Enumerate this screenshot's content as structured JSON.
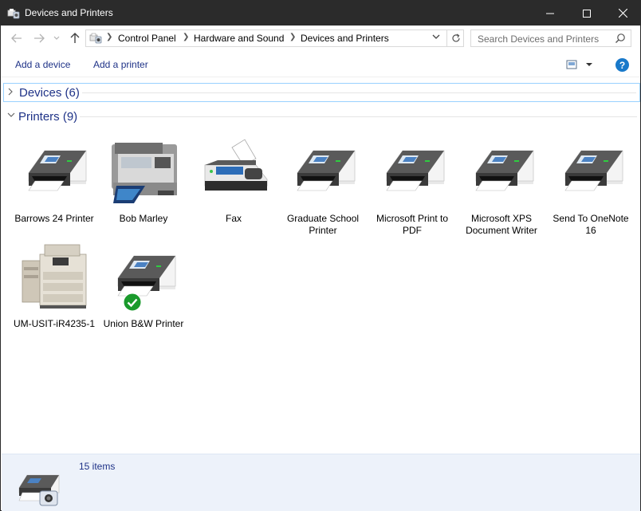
{
  "window": {
    "title": "Devices and Printers"
  },
  "address": {
    "breadcrumbs": [
      "Control Panel",
      "Hardware and Sound",
      "Devices and Printers"
    ]
  },
  "search": {
    "placeholder": "Search Devices and Printers"
  },
  "commands": {
    "add_device": "Add a device",
    "add_printer": "Add a printer",
    "help": "?"
  },
  "groups": {
    "devices": {
      "title": "Devices (6)",
      "expanded": false
    },
    "printers": {
      "title": "Printers (9)",
      "expanded": true
    }
  },
  "printers": [
    {
      "label": "Barrows 24 Printer",
      "icon": "printer-icon"
    },
    {
      "label": "Bob Marley",
      "icon": "mfp-printer-icon"
    },
    {
      "label": "Fax",
      "icon": "fax-icon"
    },
    {
      "label": "Graduate School Printer",
      "icon": "printer-icon"
    },
    {
      "label": "Microsoft Print to PDF",
      "icon": "printer-icon"
    },
    {
      "label": "Microsoft XPS Document Writer",
      "icon": "printer-icon"
    },
    {
      "label": "Send To OneNote 16",
      "icon": "printer-icon"
    },
    {
      "label": "UM-USIT-iR4235-1",
      "icon": "copier-icon"
    },
    {
      "label": "Union B&W Printer",
      "icon": "printer-icon",
      "default": true
    }
  ],
  "details": {
    "count": "15 items"
  },
  "colors": {
    "titlebar": "#2b2b2b",
    "link": "#1e3287",
    "details_bg": "#edf2fa",
    "selection": "#99d1ff"
  }
}
